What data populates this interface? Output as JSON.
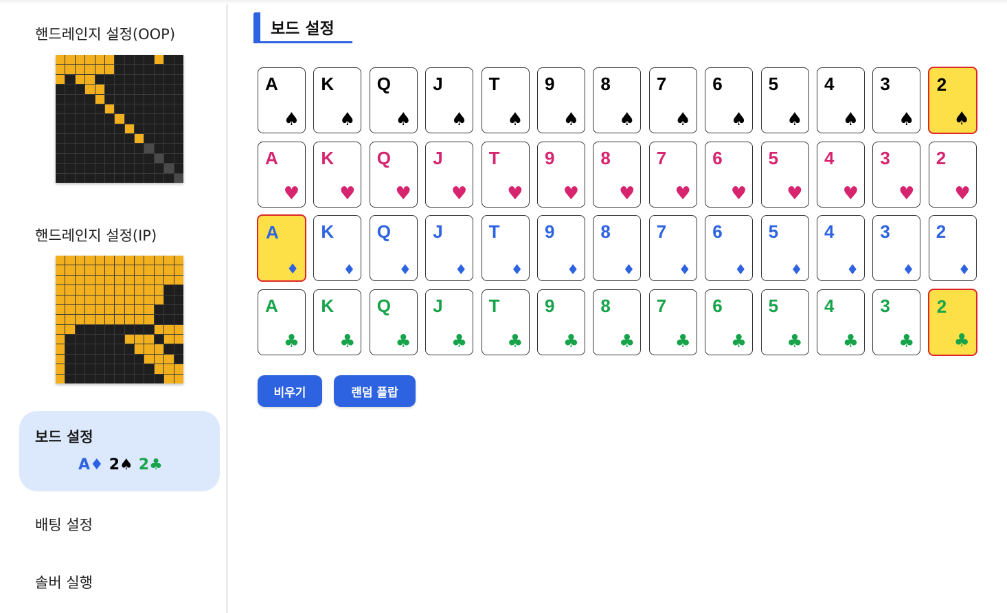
{
  "sidebar": {
    "oop_label": "핸드레인지 설정(OOP)",
    "ip_label": "핸드레인지 설정(IP)",
    "board_label": "보드 설정",
    "board_cards": [
      {
        "rank": "A",
        "suit": "♦",
        "color": "#2d63e0"
      },
      {
        "rank": "2",
        "suit": "♠",
        "color": "#000000"
      },
      {
        "rank": "2",
        "suit": "♣",
        "color": "#16a34a"
      }
    ],
    "betting_label": "배팅 설정",
    "solver_label": "솔버 실행"
  },
  "main": {
    "title": "보드 설정",
    "ranks": [
      "A",
      "K",
      "Q",
      "J",
      "T",
      "9",
      "8",
      "7",
      "6",
      "5",
      "4",
      "3",
      "2"
    ],
    "suits": [
      {
        "name": "spade",
        "symbol": "♠",
        "color": "#000000"
      },
      {
        "name": "heart",
        "symbol": "♥",
        "color": "#d6246e"
      },
      {
        "name": "diamond",
        "symbol": "♦",
        "color": "#2d63e0"
      },
      {
        "name": "club",
        "symbol": "♣",
        "color": "#16a34a"
      }
    ],
    "selected": [
      "2♠",
      "A♦",
      "2♣"
    ],
    "clear_button": "비우기",
    "random_flop_button": "랜덤 플랍"
  }
}
